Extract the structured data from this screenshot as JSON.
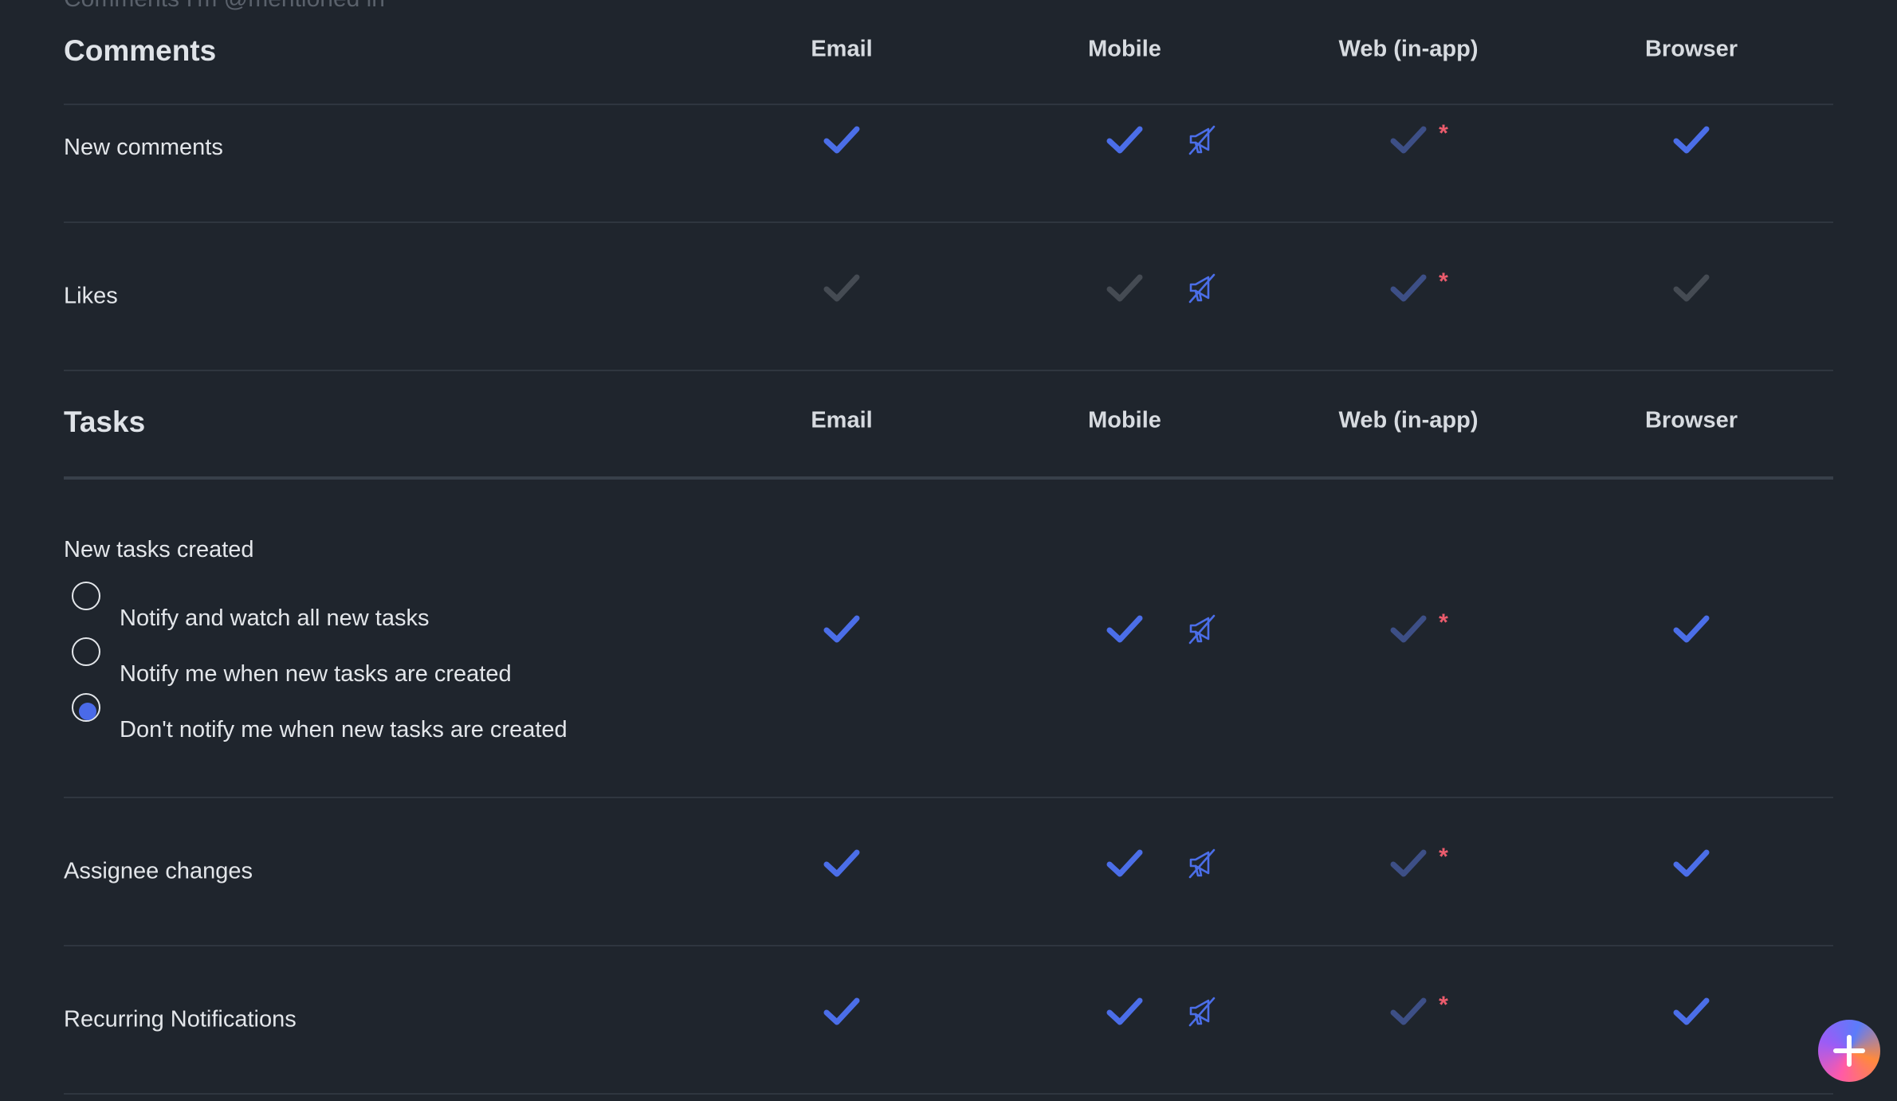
{
  "colors": {
    "background": "#1f252d",
    "check_on": "#4b6ee8",
    "check_dim": "#3d4f86",
    "check_off": "#454b53",
    "required": "#ec5c6d",
    "mute": "#4b6ee8"
  },
  "cut_row_label": "Comments I'm @mentioned in",
  "comments": {
    "title": "Comments",
    "columns": [
      "Email",
      "Mobile",
      "Web (in-app)",
      "Browser"
    ],
    "rows": [
      {
        "label": "New comments",
        "email": "on",
        "mobile": "on",
        "web": "dim",
        "browser": "on",
        "mobile_icon": "mute-megaphone-icon",
        "web_required": "*"
      },
      {
        "label": "Likes",
        "email": "off",
        "mobile": "off",
        "web": "dim",
        "browser": "off",
        "mobile_icon": "mute-megaphone-icon",
        "web_required": "*"
      }
    ]
  },
  "tasks": {
    "title": "Tasks",
    "columns": [
      "Email",
      "Mobile",
      "Web (in-app)",
      "Browser"
    ],
    "new_tasks": {
      "label": "New tasks created",
      "options": [
        "Notify and watch all new tasks",
        "Notify me when new tasks are created",
        "Don't notify me when new tasks are created"
      ],
      "selected": 2,
      "email": "on",
      "mobile": "on",
      "web": "dim",
      "browser": "on",
      "mobile_icon": "mute-megaphone-icon",
      "web_required": "*"
    },
    "rows": [
      {
        "label": "Assignee changes",
        "email": "on",
        "mobile": "on",
        "web": "dim",
        "browser": "on",
        "mobile_icon": "mute-megaphone-icon",
        "web_required": "*"
      },
      {
        "label": "Recurring Notifications",
        "email": "on",
        "mobile": "on",
        "web": "dim",
        "browser": "on",
        "mobile_icon": "mute-megaphone-icon",
        "web_required": "*"
      }
    ]
  },
  "fab_icon": "plus-icon"
}
